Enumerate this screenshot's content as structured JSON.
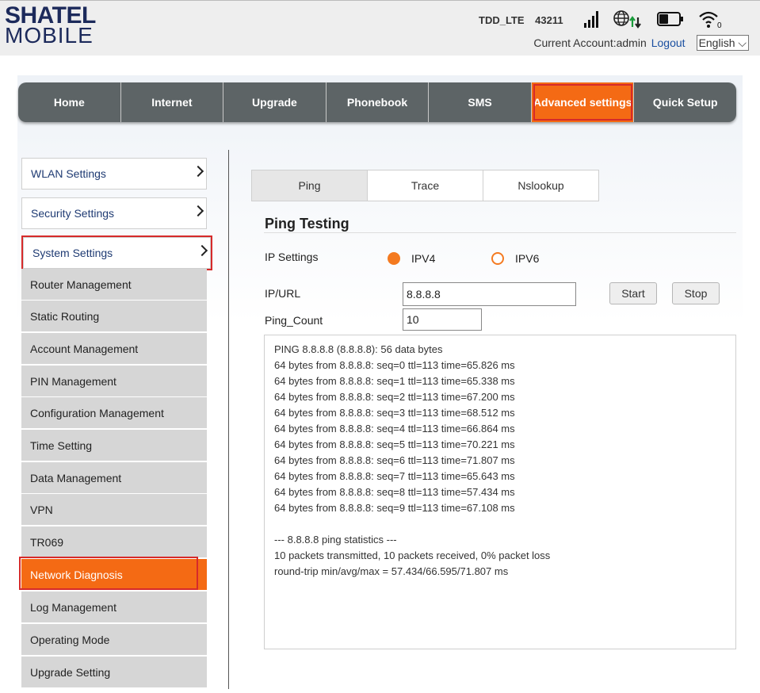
{
  "header": {
    "logo_top": "SHATEL",
    "logo_bottom": "MOBILE",
    "network": "TDD_LTE",
    "operator": "43211",
    "account_text": "Current Account:admin",
    "logout": "Logout",
    "language": "English"
  },
  "nav": {
    "tabs": [
      {
        "label": "Home"
      },
      {
        "label": "Internet"
      },
      {
        "label": "Upgrade"
      },
      {
        "label": "Phonebook"
      },
      {
        "label": "SMS"
      },
      {
        "label": "Advanced settings"
      },
      {
        "label": "Quick Setup"
      }
    ],
    "active": "Advanced settings"
  },
  "sidebar": {
    "groups": [
      {
        "label": "WLAN Settings"
      },
      {
        "label": "Security Settings"
      },
      {
        "label": "System Settings"
      }
    ],
    "items": [
      {
        "label": "Router Management"
      },
      {
        "label": "Static Routing"
      },
      {
        "label": "Account Management"
      },
      {
        "label": "PIN Management"
      },
      {
        "label": "Configuration Management"
      },
      {
        "label": "Time Setting"
      },
      {
        "label": "Data Management"
      },
      {
        "label": "VPN"
      },
      {
        "label": "TR069"
      },
      {
        "label": "Network Diagnosis"
      },
      {
        "label": "Log Management"
      },
      {
        "label": "Operating Mode"
      },
      {
        "label": "Upgrade Setting"
      }
    ],
    "active_item": "Network Diagnosis"
  },
  "content": {
    "tabs": [
      {
        "label": "Ping"
      },
      {
        "label": "Trace"
      },
      {
        "label": "Nslookup"
      }
    ],
    "active_tab": "Ping",
    "title": "Ping Testing",
    "ip_settings_label": "IP Settings",
    "ipv4_label": "IPV4",
    "ipv6_label": "IPV6",
    "ip_url_label": "IP/URL",
    "ip_url_value": "8.8.8.8",
    "ping_count_label": "Ping_Count",
    "ping_count_value": "10",
    "start_label": "Start",
    "stop_label": "Stop",
    "output_lines": [
      "PING 8.8.8.8 (8.8.8.8): 56 data bytes",
      "64 bytes from 8.8.8.8: seq=0 ttl=113 time=65.826 ms",
      "64 bytes from 8.8.8.8: seq=1 ttl=113 time=65.338 ms",
      "64 bytes from 8.8.8.8: seq=2 ttl=113 time=67.200 ms",
      "64 bytes from 8.8.8.8: seq=3 ttl=113 time=68.512 ms",
      "64 bytes from 8.8.8.8: seq=4 ttl=113 time=66.864 ms",
      "64 bytes from 8.8.8.8: seq=5 ttl=113 time=70.221 ms",
      "64 bytes from 8.8.8.8: seq=6 ttl=113 time=71.807 ms",
      "64 bytes from 8.8.8.8: seq=7 ttl=113 time=65.643 ms",
      "64 bytes from 8.8.8.8: seq=8 ttl=113 time=57.434 ms",
      "64 bytes from 8.8.8.8: seq=9 ttl=113 time=67.108 ms",
      "",
      "--- 8.8.8.8 ping statistics ---",
      "10 packets transmitted, 10 packets received, 0% packet loss",
      "round-trip min/avg/max = 57.434/66.595/71.807 ms"
    ]
  },
  "colors": {
    "accent": "#f46a14",
    "nav_bg": "#5d6466",
    "highlight_border": "#d62a2a",
    "logo": "#1c2a5b"
  }
}
